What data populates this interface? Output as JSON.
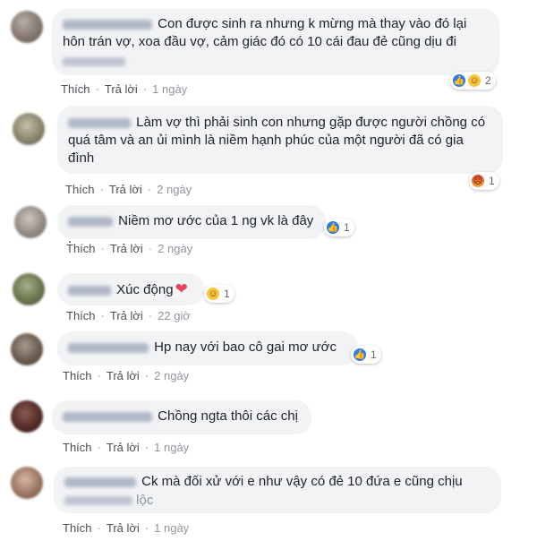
{
  "actions": {
    "like": "Thích",
    "reply": "Trả lời",
    "separator": "·"
  },
  "comments": [
    {
      "text": "Con được sinh ra nhưng k mừng mà thay vào đó lại hôn trán vợ, xoa đầu vợ, cảm giác đó có 10 cái đau đẻ cũng dịu đi",
      "time": "1 ngày",
      "reactions": [
        "like",
        "haha"
      ],
      "count": "2"
    },
    {
      "text": "Làm vợ thì phải sinh con nhưng gặp được người chồng có quá tâm và an ủi mình là niềm hạnh phúc của một người đã có gia đình",
      "time": "2 ngày",
      "reactions": [
        "angry"
      ],
      "count": "1"
    },
    {
      "text": "Niềm mơ ước của 1 ng vk là đây .",
      "time": "2 ngày",
      "reactions": [
        "like"
      ],
      "count": "1"
    },
    {
      "text": "Xúc động",
      "time": "22 giờ",
      "reactions": [
        "haha"
      ],
      "count": "1"
    },
    {
      "text": "Hp nay với bao cô gai mơ ước",
      "time": "2 ngày",
      "reactions": [
        "like"
      ],
      "count": "1"
    },
    {
      "text": "Chồng ngta thôi các chị",
      "time": "1 ngày",
      "reactions": [],
      "count": ""
    },
    {
      "text": "Ck mà đối xử với e như vậy có đẻ 10 đứa e cũng chịu",
      "text_line2_fragment": "lộc",
      "time": "1 ngày",
      "reactions": [],
      "count": ""
    }
  ]
}
